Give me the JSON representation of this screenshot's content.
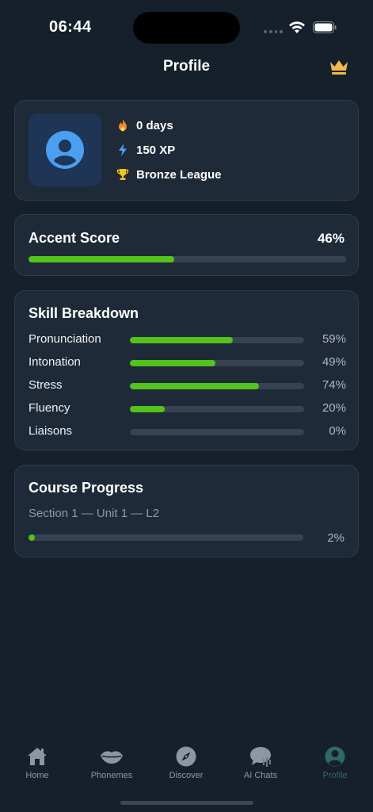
{
  "status_bar": {
    "time": "06:44"
  },
  "header": {
    "title": "Profile"
  },
  "profile": {
    "streak": "0 days",
    "xp": "150 XP",
    "league": "Bronze League"
  },
  "accent_score": {
    "title": "Accent Score",
    "value_label": "46%",
    "value": 46
  },
  "skills": {
    "title": "Skill Breakdown",
    "items": [
      {
        "label": "Pronunciation",
        "pct_label": "59%",
        "value": 59
      },
      {
        "label": "Intonation",
        "pct_label": "49%",
        "value": 49
      },
      {
        "label": "Stress",
        "pct_label": "74%",
        "value": 74
      },
      {
        "label": "Fluency",
        "pct_label": "20%",
        "value": 20
      },
      {
        "label": "Liaisons",
        "pct_label": "0%",
        "value": 0
      }
    ]
  },
  "course": {
    "title": "Course Progress",
    "subtitle": "Section 1 — Unit 1 — L2",
    "pct_label": "2%",
    "value": 2
  },
  "tabbar": {
    "items": [
      {
        "label": "Home",
        "icon": "home-icon"
      },
      {
        "label": "Phonemes",
        "icon": "lips-icon"
      },
      {
        "label": "Discover",
        "icon": "compass-icon"
      },
      {
        "label": "AI Chats",
        "icon": "chat-icon"
      },
      {
        "label": "Profile",
        "icon": "profile-icon",
        "active": true
      }
    ]
  },
  "colors": {
    "accent_green": "#52c41a",
    "active_tab": "#2d6a63",
    "crown": "#f5b942"
  }
}
